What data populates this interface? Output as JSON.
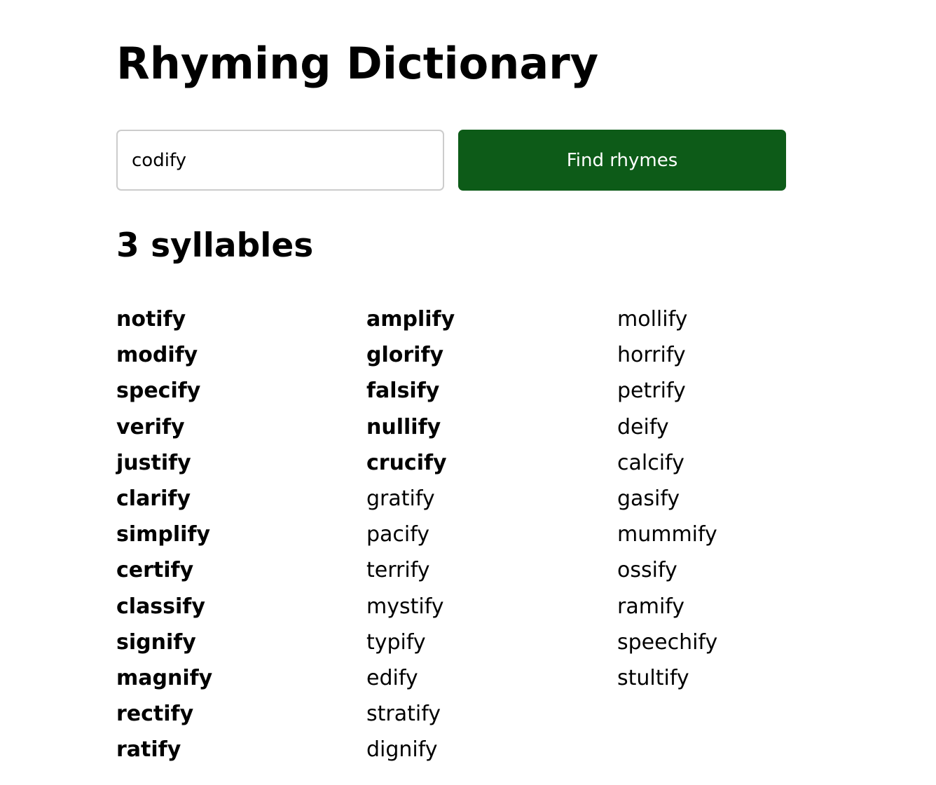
{
  "page": {
    "title": "Rhyming Dictionary"
  },
  "search": {
    "value": "codify",
    "button_label": "Find rhymes"
  },
  "colors": {
    "button_bg": "#0d5b18",
    "button_text": "#ffffff",
    "input_border": "#cccccc"
  },
  "results": {
    "heading": "3 syllables",
    "columns": [
      [
        {
          "word": "notify",
          "bold": true
        },
        {
          "word": "modify",
          "bold": true
        },
        {
          "word": "specify",
          "bold": true
        },
        {
          "word": "verify",
          "bold": true
        },
        {
          "word": "justify",
          "bold": true
        },
        {
          "word": "clarify",
          "bold": true
        },
        {
          "word": "simplify",
          "bold": true
        },
        {
          "word": "certify",
          "bold": true
        },
        {
          "word": "classify",
          "bold": true
        },
        {
          "word": "signify",
          "bold": true
        },
        {
          "word": "magnify",
          "bold": true
        },
        {
          "word": "rectify",
          "bold": true
        },
        {
          "word": "ratify",
          "bold": true
        }
      ],
      [
        {
          "word": "amplify",
          "bold": true
        },
        {
          "word": "glorify",
          "bold": true
        },
        {
          "word": "falsify",
          "bold": true
        },
        {
          "word": "nullify",
          "bold": true
        },
        {
          "word": "crucify",
          "bold": true
        },
        {
          "word": "gratify",
          "bold": false
        },
        {
          "word": "pacify",
          "bold": false
        },
        {
          "word": "terrify",
          "bold": false
        },
        {
          "word": "mystify",
          "bold": false
        },
        {
          "word": "typify",
          "bold": false
        },
        {
          "word": "edify",
          "bold": false
        },
        {
          "word": "stratify",
          "bold": false
        },
        {
          "word": "dignify",
          "bold": false
        }
      ],
      [
        {
          "word": "mollify",
          "bold": false
        },
        {
          "word": "horrify",
          "bold": false
        },
        {
          "word": "petrify",
          "bold": false
        },
        {
          "word": "deify",
          "bold": false
        },
        {
          "word": "calcify",
          "bold": false
        },
        {
          "word": "gasify",
          "bold": false
        },
        {
          "word": "mummify",
          "bold": false
        },
        {
          "word": "ossify",
          "bold": false
        },
        {
          "word": "ramify",
          "bold": false
        },
        {
          "word": "speechify",
          "bold": false
        },
        {
          "word": "stultify",
          "bold": false
        }
      ]
    ]
  }
}
